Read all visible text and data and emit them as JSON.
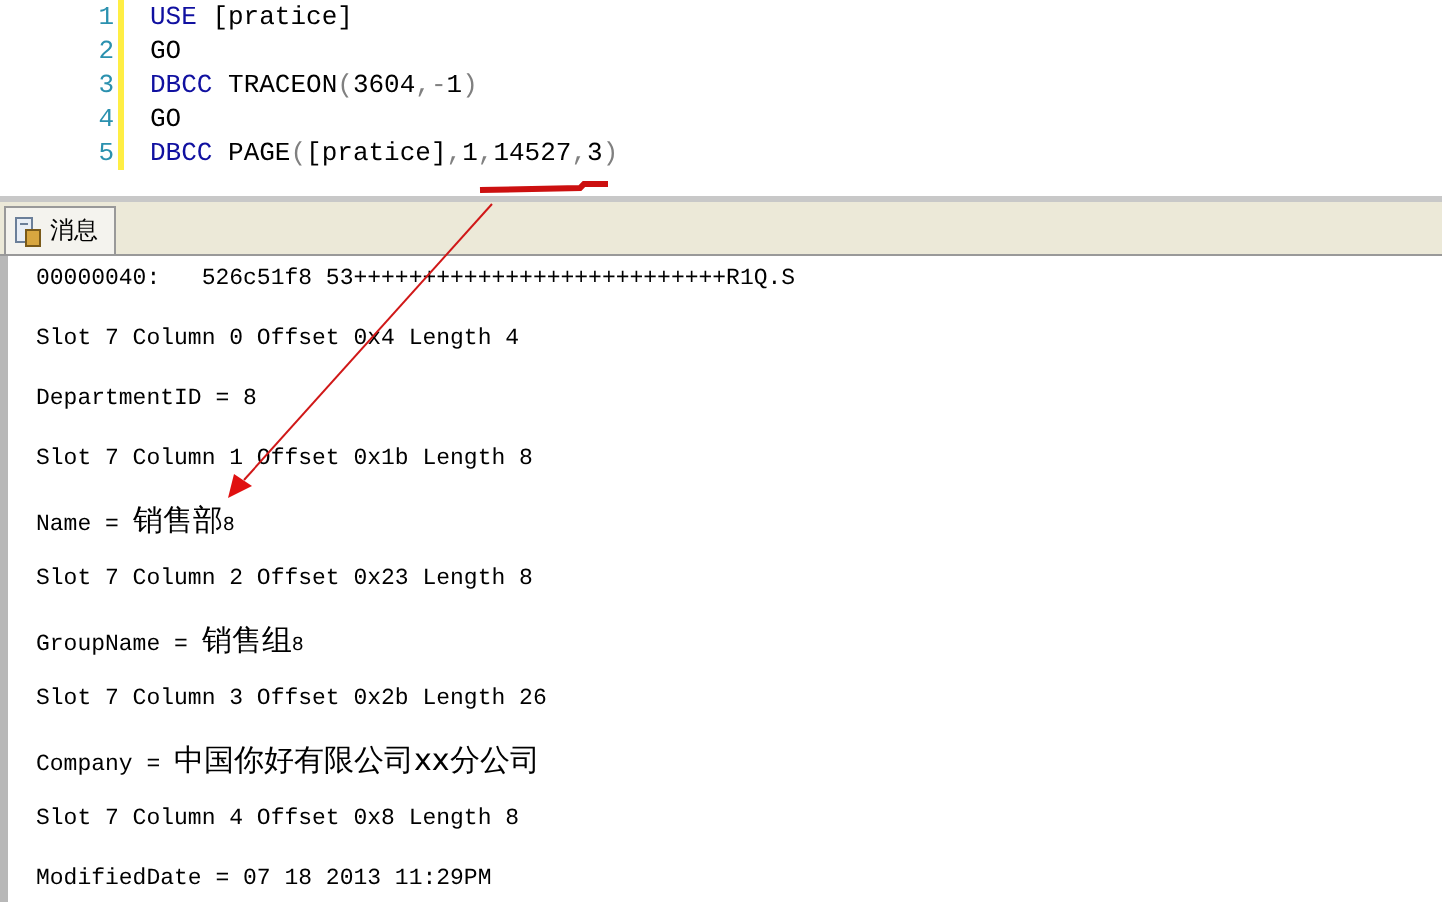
{
  "editor": {
    "lines": [
      {
        "number": "1",
        "tokens": [
          {
            "text": "USE",
            "kind": "keyword"
          },
          {
            "text": " [pratice]",
            "kind": "plain"
          }
        ]
      },
      {
        "number": "2",
        "tokens": [
          {
            "text": "GO",
            "kind": "plain"
          }
        ]
      },
      {
        "number": "3",
        "tokens": [
          {
            "text": "DBCC",
            "kind": "keyword"
          },
          {
            "text": " TRACEON",
            "kind": "plain"
          },
          {
            "text": "(",
            "kind": "punct"
          },
          {
            "text": "3604",
            "kind": "plain"
          },
          {
            "text": ",-",
            "kind": "punct"
          },
          {
            "text": "1",
            "kind": "plain"
          },
          {
            "text": ")",
            "kind": "punct"
          }
        ]
      },
      {
        "number": "4",
        "tokens": [
          {
            "text": "GO",
            "kind": "plain"
          }
        ]
      },
      {
        "number": "5",
        "tokens": [
          {
            "text": "DBCC",
            "kind": "keyword"
          },
          {
            "text": " PAGE",
            "kind": "plain"
          },
          {
            "text": "(",
            "kind": "punct"
          },
          {
            "text": "[pratice]",
            "kind": "plain"
          },
          {
            "text": ",",
            "kind": "punct"
          },
          {
            "text": "1",
            "kind": "plain"
          },
          {
            "text": ",",
            "kind": "punct"
          },
          {
            "text": "14527",
            "kind": "plain"
          },
          {
            "text": ",",
            "kind": "punct"
          },
          {
            "text": "3",
            "kind": "plain"
          },
          {
            "text": ")",
            "kind": "punct"
          }
        ]
      }
    ]
  },
  "tabs": [
    {
      "label": "消息",
      "selected": true
    }
  ],
  "messages": [
    [
      {
        "text": "00000040:   526c51f8 53+++++++++++++++++++++++++++R1Q.S",
        "kind": "mono"
      }
    ],
    [
      {
        "text": "Slot 7 Column 0 Offset 0x4 Length 4",
        "kind": "mono"
      }
    ],
    [
      {
        "text": "DepartmentID = 8",
        "kind": "mono"
      }
    ],
    [
      {
        "text": "Slot 7 Column 1 Offset 0x1b Length 8",
        "kind": "mono"
      }
    ],
    [
      {
        "text": "Name = ",
        "kind": "mono"
      },
      {
        "text": "销售部",
        "kind": "cjk"
      },
      {
        "text": "8",
        "kind": "small"
      }
    ],
    [
      {
        "text": "Slot 7 Column 2 Offset 0x23 Length 8",
        "kind": "mono"
      }
    ],
    [
      {
        "text": "GroupName = ",
        "kind": "mono"
      },
      {
        "text": "销售组",
        "kind": "cjk"
      },
      {
        "text": "8",
        "kind": "small"
      }
    ],
    [
      {
        "text": "Slot 7 Column 3 Offset 0x2b Length 26",
        "kind": "mono"
      }
    ],
    [
      {
        "text": "Company = ",
        "kind": "mono"
      },
      {
        "text": "中国你好有限公司xx分公司",
        "kind": "cjk"
      }
    ],
    [
      {
        "text": "Slot 7 Column 4 Offset 0x8 Length 8",
        "kind": "mono"
      }
    ],
    [
      {
        "text": "ModifiedDate = 07 18 2013 11:29PM",
        "kind": "mono"
      }
    ]
  ]
}
